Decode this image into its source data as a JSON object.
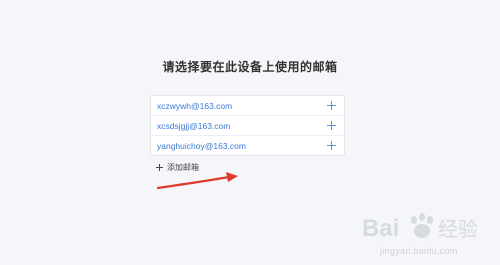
{
  "page": {
    "title": "请选择要在此设备上使用的邮箱"
  },
  "accounts": [
    {
      "email": "xczwywh@163.com",
      "action_icon": "plus-icon"
    },
    {
      "email": "xcsdsjgjj@163.com",
      "action_icon": "plus-icon"
    },
    {
      "email": "yanghuichoy@163.com",
      "action_icon": "plus-icon"
    }
  ],
  "add_mailbox": {
    "label": "添加邮箱",
    "icon": "plus-icon"
  },
  "annotation": {
    "icon": "arrow-icon",
    "color": "#e03a2e"
  },
  "watermark": {
    "logo_text": "Bai 经验",
    "url": "jingyan.baidu.com"
  },
  "colors": {
    "background": "#f5f6f9",
    "email_link": "#3a7ad8",
    "plus": "#5b8fe0"
  }
}
